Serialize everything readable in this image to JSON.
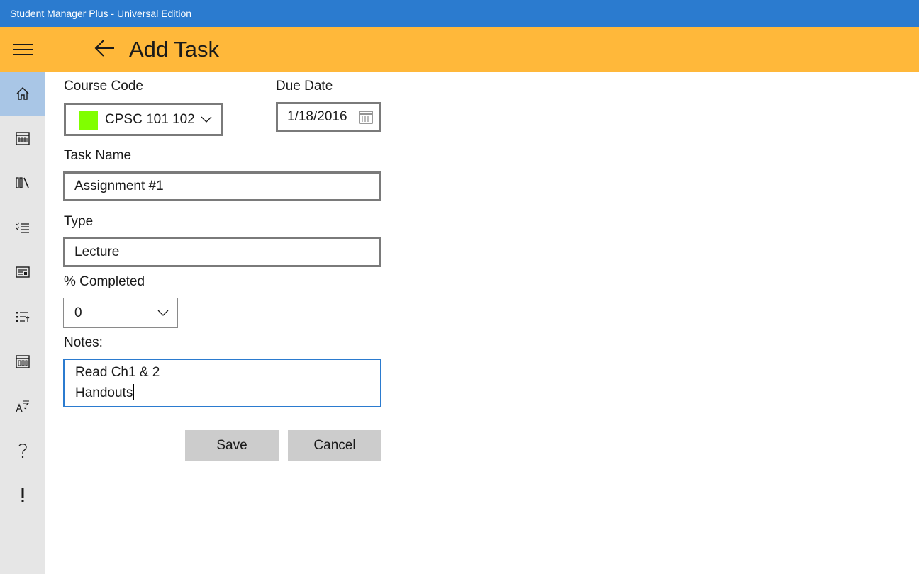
{
  "window": {
    "title": "Student Manager Plus - Universal Edition"
  },
  "header": {
    "title": "Add Task",
    "accent_color": "#ffb83a"
  },
  "sidebar": {
    "items": [
      {
        "icon": "home-icon",
        "active": true
      },
      {
        "icon": "calendar-icon",
        "active": false
      },
      {
        "icon": "library-icon",
        "active": false
      },
      {
        "icon": "checklist-icon",
        "active": false
      },
      {
        "icon": "news-icon",
        "active": false
      },
      {
        "icon": "task-list-icon",
        "active": false
      },
      {
        "icon": "calendar-week-icon",
        "active": false
      },
      {
        "icon": "translate-icon",
        "active": false
      },
      {
        "icon": "help-icon",
        "active": false
      },
      {
        "icon": "exclamation-icon",
        "active": false
      }
    ]
  },
  "form": {
    "course_code": {
      "label": "Course Code",
      "value": "CPSC 101 102",
      "color": "#80ff00"
    },
    "due_date": {
      "label": "Due Date",
      "value": "1/18/2016"
    },
    "task_name": {
      "label": "Task Name",
      "value": "Assignment #1"
    },
    "type": {
      "label": "Type",
      "value": "Lecture"
    },
    "percent_completed": {
      "label": "% Completed",
      "value": "0"
    },
    "notes": {
      "label": "Notes:",
      "line1": "Read Ch1 & 2",
      "line2": "Handouts"
    }
  },
  "actions": {
    "save_label": "Save",
    "cancel_label": "Cancel"
  }
}
